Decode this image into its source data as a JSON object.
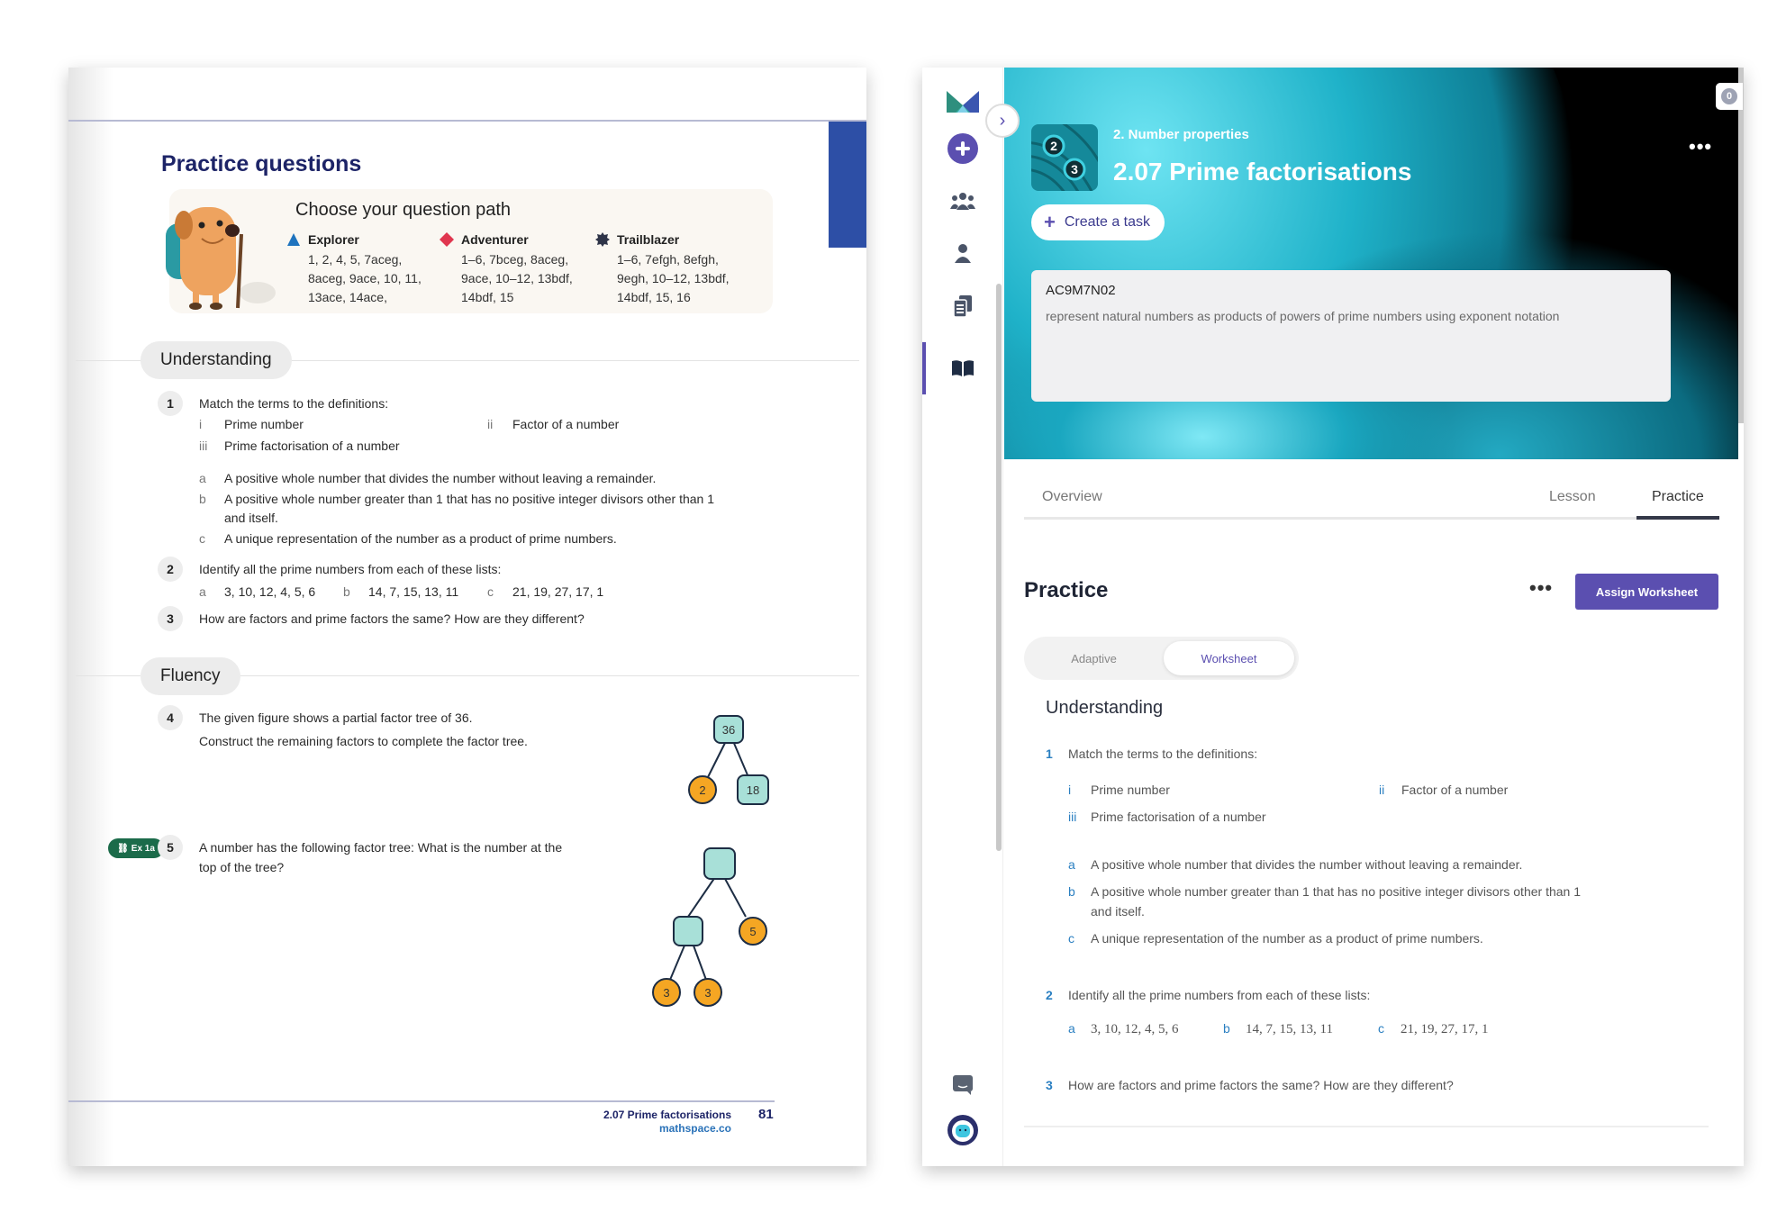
{
  "book": {
    "title": "Practice questions",
    "path_card": {
      "title": "Choose your question path",
      "paths": [
        {
          "name": "Explorer",
          "icon": "blue-triangle-icon",
          "color": "#1e73be",
          "values": [
            "1, 2, 4, 5, 7aceg,",
            "8aceg, 9ace, 10, 11,",
            "13ace, 14ace,"
          ]
        },
        {
          "name": "Adventurer",
          "icon": "red-diamond-icon",
          "color": "#e0364f",
          "values": [
            "1–6, 7bceg, 8aceg,",
            "9ace, 10–12, 13bdf,",
            "14bdf, 15"
          ]
        },
        {
          "name": "Trailblazer",
          "icon": "dark-badge-icon",
          "color": "#2e3448",
          "values": [
            "1–6, 7efgh, 8efgh,",
            "9egh, 10–12, 13bdf,",
            "14bdf, 15, 16"
          ]
        }
      ]
    },
    "sections": {
      "understanding": "Understanding",
      "fluency": "Fluency"
    },
    "q1": {
      "num": "1",
      "text": "Match the terms to the definitions:",
      "terms": [
        {
          "label": "i",
          "text": "Prime number"
        },
        {
          "label": "ii",
          "text": "Factor of a number"
        },
        {
          "label": "iii",
          "text": "Prime factorisation of a number"
        }
      ],
      "defs": [
        {
          "label": "a",
          "text": "A positive whole number that divides the number without leaving a remainder."
        },
        {
          "label": "b",
          "text": "A positive whole number greater than 1 that has no positive integer divisors other than 1",
          "cont": "and itself."
        },
        {
          "label": "c",
          "text": "A unique representation of the number as a product of prime numbers."
        }
      ]
    },
    "q2": {
      "num": "2",
      "text": "Identify all the prime numbers from each of these lists:",
      "parts": [
        {
          "label": "a",
          "text": "3, 10, 12, 4, 5, 6"
        },
        {
          "label": "b",
          "text": "14, 7, 15, 13, 11"
        },
        {
          "label": "c",
          "text": "21, 19, 27, 17, 1"
        }
      ]
    },
    "q3": {
      "num": "3",
      "text": "How are factors and prime factors the same? How are they different?"
    },
    "q4": {
      "num": "4",
      "line1": "The given figure shows a partial factor tree of 36.",
      "line2": "Construct the remaining factors to complete the factor tree.",
      "tree": {
        "root": "36",
        "left": "2",
        "right": "18"
      }
    },
    "q5": {
      "num": "5",
      "badge": "Ex 1a",
      "line1": "A number has the following factor tree: What is the number at the",
      "line2": "top of the tree?",
      "tree": {
        "root": "",
        "mid": "",
        "right": "5",
        "leaf1": "3",
        "leaf2": "3"
      }
    },
    "footer": {
      "title": "2.07 Prime factorisations",
      "site": "mathspace.co",
      "page": "81"
    }
  },
  "app": {
    "notifications": "0",
    "hero": {
      "breadcrumb": "2. Number properties",
      "title": "2.07 Prime factorisations",
      "create_task": "Create a task",
      "outcome_code": "AC9M7N02",
      "outcome_desc": "represent natural numbers as products of powers of prime numbers using exponent notation"
    },
    "tabs": [
      {
        "label": "Overview",
        "active": false
      },
      {
        "label": "Lesson",
        "active": false
      },
      {
        "label": "Practice",
        "active": true
      }
    ],
    "practice": {
      "title": "Practice",
      "assign_label": "Assign Worksheet",
      "modes": [
        {
          "label": "Adaptive",
          "active": false
        },
        {
          "label": "Worksheet",
          "active": true
        }
      ]
    },
    "worksheet": {
      "heading": "Understanding",
      "q1": {
        "num": "1",
        "text": "Match the terms to the definitions:",
        "terms": [
          {
            "label": "i",
            "text": "Prime number"
          },
          {
            "label": "ii",
            "text": "Factor of a number"
          },
          {
            "label": "iii",
            "text": "Prime factorisation of a number"
          }
        ],
        "defs": [
          {
            "label": "a",
            "text": "A positive whole number that divides the number without leaving a remainder."
          },
          {
            "label": "b",
            "text": "A positive whole number greater than 1 that has no positive integer divisors other than 1",
            "cont": "and itself."
          },
          {
            "label": "c",
            "text": "A unique representation of the number as a product of prime numbers."
          }
        ]
      },
      "q2": {
        "num": "2",
        "text": "Identify all the prime numbers from each of these lists:",
        "parts": [
          {
            "label": "a",
            "text": "3, 10, 12, 4, 5, 6"
          },
          {
            "label": "b",
            "text": "14, 7, 15, 13, 11"
          },
          {
            "label": "c",
            "text": "21, 19, 27, 17, 1"
          }
        ]
      },
      "q3": {
        "num": "3",
        "text": "How are factors and prime factors the same? How are they different?"
      }
    },
    "colors": {
      "accent": "#5b4fb0",
      "link_blue": "#2a7fc1",
      "tree_node": "#a8e0d8",
      "tree_leaf": "#f5a623"
    }
  }
}
